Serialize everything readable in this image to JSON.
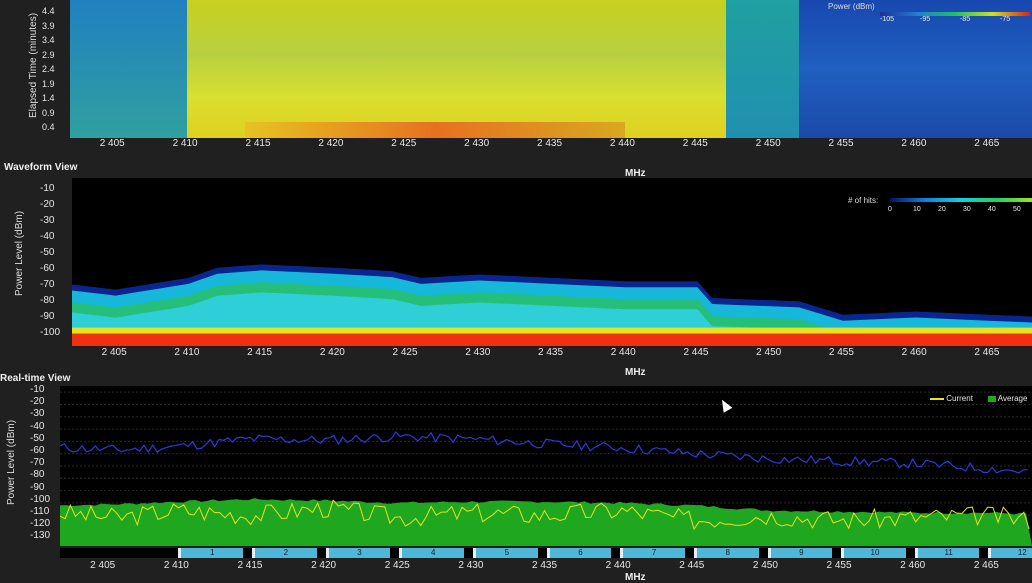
{
  "spectrogram": {
    "ytitle": "Elapsed Time (minutes)",
    "yticks": [
      "4.4",
      "3.9",
      "3.4",
      "2.9",
      "2.4",
      "1.9",
      "1.4",
      "0.9",
      "0.4"
    ],
    "colorbar_title": "Power (dBm)",
    "colorbar_ticks": [
      "-105",
      "-95",
      "-85",
      "-75"
    ]
  },
  "waveform": {
    "title": "Waveform View",
    "ytitle": "Power Level (dBm)",
    "yticks": [
      "-10",
      "-20",
      "-30",
      "-40",
      "-50",
      "-60",
      "-70",
      "-80",
      "-90",
      "-100"
    ],
    "legend_title": "# of hits:",
    "legend_ticks": [
      "0",
      "10",
      "20",
      "30",
      "40",
      "50"
    ]
  },
  "realtime": {
    "title": "Real-time View",
    "ytitle": "Power Level (dBm)",
    "yticks": [
      "-10",
      "-20",
      "-30",
      "-40",
      "-50",
      "-60",
      "-70",
      "-80",
      "-90",
      "-100",
      "-110",
      "-120",
      "-130"
    ],
    "legend_current": "Current",
    "legend_average": "Average",
    "channels": [
      "1",
      "2",
      "3",
      "4",
      "5",
      "6",
      "7",
      "8",
      "9",
      "10",
      "11",
      "12"
    ]
  },
  "xaxis": {
    "ticks": [
      "2 405",
      "2 410",
      "2 415",
      "2 420",
      "2 425",
      "2 430",
      "2 435",
      "2 440",
      "2 445",
      "2 450",
      "2 455",
      "2 460",
      "2 465"
    ],
    "label": "MHz"
  },
  "colors": {
    "background": "#202020",
    "plot_bg": "#000000",
    "current_trace": "#e8e020",
    "average_fill": "#1fa81f",
    "max_trace": "#2a3bd8",
    "channel_bar": "#4fb8d8"
  },
  "chart_data": [
    {
      "type": "heatmap",
      "ylabel": "Elapsed Time (minutes)",
      "xlabel": "MHz",
      "xlim": [
        2402,
        2468
      ],
      "ylim": [
        0,
        4.6
      ],
      "band_levels": [
        {
          "from": 2402,
          "to": 2410,
          "level": -92
        },
        {
          "from": 2410,
          "to": 2447,
          "level": -72
        },
        {
          "from": 2447,
          "to": 2452,
          "level": -88
        },
        {
          "from": 2452,
          "to": 2468,
          "level": -98
        }
      ]
    },
    {
      "type": "area",
      "ylabel": "Power Level (dBm)",
      "xlabel": "MHz",
      "xlim": [
        2402,
        2468
      ],
      "ylim": [
        -105,
        -5
      ],
      "envelope": {
        "x": [
          2402,
          2405,
          2410,
          2412,
          2415,
          2420,
          2424,
          2426,
          2430,
          2435,
          2440,
          2445,
          2446,
          2452,
          2455,
          2460,
          2465,
          2468
        ],
        "y": [
          -72,
          -75,
          -68,
          -62,
          -60,
          -62,
          -64,
          -68,
          -66,
          -68,
          -70,
          -70,
          -80,
          -82,
          -90,
          -88,
          -90,
          -91
        ]
      },
      "noise_floor": -100
    },
    {
      "type": "line",
      "ylabel": "Power Level (dBm)",
      "xlabel": "MHz",
      "xlim": [
        2402,
        2468
      ],
      "ylim": [
        -135,
        -5
      ],
      "series": [
        {
          "name": "Current",
          "x": [
            2402,
            2406,
            2410,
            2415,
            2420,
            2425,
            2430,
            2435,
            2440,
            2445,
            2450,
            2455,
            2460,
            2465,
            2468
          ],
          "y": [
            -108,
            -112,
            -106,
            -110,
            -104,
            -112,
            -108,
            -110,
            -106,
            -114,
            -110,
            -114,
            -112,
            -110,
            -114
          ]
        },
        {
          "name": "Average",
          "x": [
            2402,
            2406,
            2410,
            2415,
            2420,
            2425,
            2430,
            2435,
            2440,
            2445,
            2450,
            2455,
            2460,
            2465,
            2468
          ],
          "y": [
            -102,
            -101,
            -99,
            -97,
            -98,
            -100,
            -99,
            -99,
            -100,
            -102,
            -106,
            -107,
            -108,
            -108,
            -109
          ]
        },
        {
          "x": [
            2402,
            2406,
            2410,
            2415,
            2420,
            2425,
            2430,
            2435,
            2440,
            2445,
            2450,
            2455,
            2460,
            2465,
            2468
          ],
          "y": [
            -55,
            -57,
            -54,
            -48,
            -49,
            -46,
            -48,
            -52,
            -55,
            -60,
            -64,
            -66,
            -68,
            -72,
            -75
          ]
        }
      ]
    }
  ]
}
